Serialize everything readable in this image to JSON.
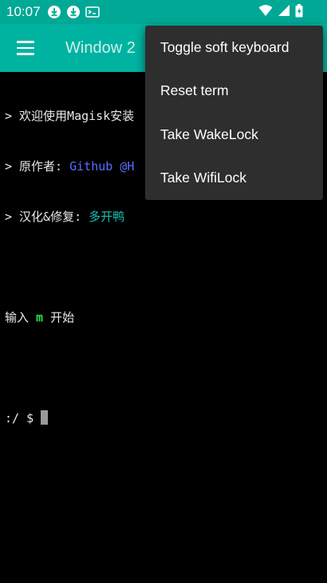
{
  "status_bar": {
    "time": "10:07",
    "icons": [
      "download-icon",
      "download-icon",
      "terminal-notification-icon"
    ],
    "right_icons": [
      "wifi-icon",
      "signal-icon",
      "battery-icon"
    ]
  },
  "app_bar": {
    "menu_icon": "hamburger-icon",
    "title": "Window 2"
  },
  "terminal": {
    "lines": [
      {
        "prefix": "> 欢迎使用Magisk安装"
      },
      {
        "prefix": "> 原作者: ",
        "highlight": "Github @H",
        "color": "#5b6cff"
      },
      {
        "prefix": "> 汉化&修复: ",
        "highlight": "多开鸭",
        "color": "#15c0b0"
      },
      {
        "prefix": ""
      },
      {
        "prefix": "输入 ",
        "highlight": "m",
        "suffix": " 开始",
        "color": "#2ee04a"
      },
      {
        "prefix": ""
      },
      {
        "prefix": ":/ $ "
      }
    ]
  },
  "menu": {
    "items": [
      "Toggle soft keyboard",
      "Reset term",
      "Take WakeLock",
      "Take WifiLock"
    ]
  },
  "colors": {
    "status_bar": "#00a896",
    "app_bar": "#00b3a0",
    "menu_bg": "#2e2e2e",
    "terminal_bg": "#000000"
  }
}
